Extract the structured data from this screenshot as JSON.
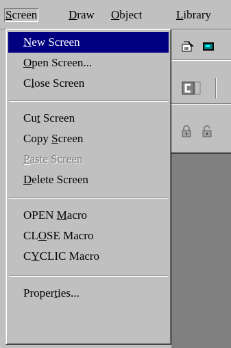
{
  "menubar": {
    "screen": {
      "pre": "",
      "key": "S",
      "post": "creen"
    },
    "draw": {
      "pre": "",
      "key": "D",
      "post": "raw"
    },
    "object": {
      "pre": "",
      "key": "O",
      "post": "bject"
    },
    "library": {
      "pre": "",
      "key": "L",
      "post": "ibrary"
    }
  },
  "menu": {
    "new_screen": {
      "pre": "",
      "key": "N",
      "post": "ew Screen"
    },
    "open_screen": {
      "pre": "",
      "key": "O",
      "post": "pen Screen..."
    },
    "close_screen": {
      "pre": "C",
      "key": "l",
      "post": "ose Screen"
    },
    "cut_screen": {
      "pre": "Cu",
      "key": "t",
      "post": " Screen"
    },
    "copy_screen": {
      "pre": "Copy ",
      "key": "S",
      "post": "creen"
    },
    "paste_screen": {
      "pre": "",
      "key": "P",
      "post": "aste Screen"
    },
    "delete_screen": {
      "pre": "",
      "key": "D",
      "post": "elete Screen"
    },
    "open_macro": {
      "pre": "OPEN ",
      "key": "M",
      "post": "acro"
    },
    "close_macro": {
      "pre": "CL",
      "key": "O",
      "post": "SE Macro"
    },
    "cyclic_macro": {
      "pre": "C",
      "key": "Y",
      "post": "CLIC Macro"
    },
    "properties": {
      "pre": "Proper",
      "key": "t",
      "post": "ies..."
    }
  },
  "icons": [
    "import-icon",
    "display-icon",
    "component-icon",
    "lock-icon",
    "unlock-icon"
  ],
  "colors": {
    "highlight": "#000080",
    "face": "#c0c0c0",
    "workspace": "#808080"
  }
}
